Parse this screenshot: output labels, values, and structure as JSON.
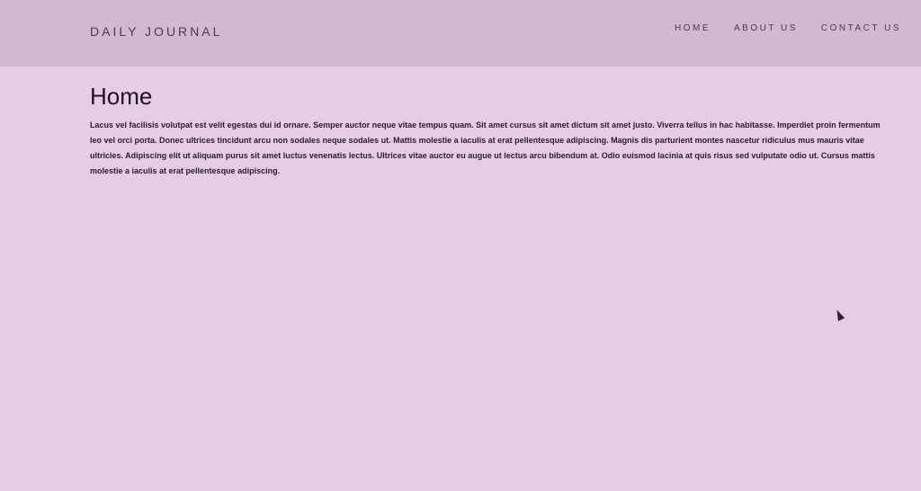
{
  "header": {
    "brand": "DAILY JOURNAL",
    "nav": [
      {
        "label": "HOME"
      },
      {
        "label": "ABOUT US"
      },
      {
        "label": "CONTACT US"
      }
    ]
  },
  "main": {
    "title": "Home",
    "paragraph": "Lacus vel facilisis volutpat est velit egestas dui id ornare. Semper auctor neque vitae tempus quam. Sit amet cursus sit amet dictum sit amet justo. Viverra tellus in hac habitasse. Imperdiet proin fermentum leo vel orci porta. Donec ultrices tincidunt arcu non sodales neque sodales ut. Mattis molestie a iaculis at erat pellentesque adipiscing. Magnis dis parturient montes nascetur ridiculus mus mauris vitae ultricies. Adipiscing elit ut aliquam purus sit amet luctus venenatis lectus. Ultrices vitae auctor eu augue ut lectus arcu bibendum at. Odio euismod lacinia at quis risus sed vulputate odio ut. Cursus mattis molestie a iaculis at erat pellentesque adipiscing."
  },
  "colors": {
    "background": "#e6cde4",
    "navbar": "#d2b8d0",
    "text": "#2a2030"
  },
  "icons": {
    "cursor": "mouse-pointer-icon"
  }
}
